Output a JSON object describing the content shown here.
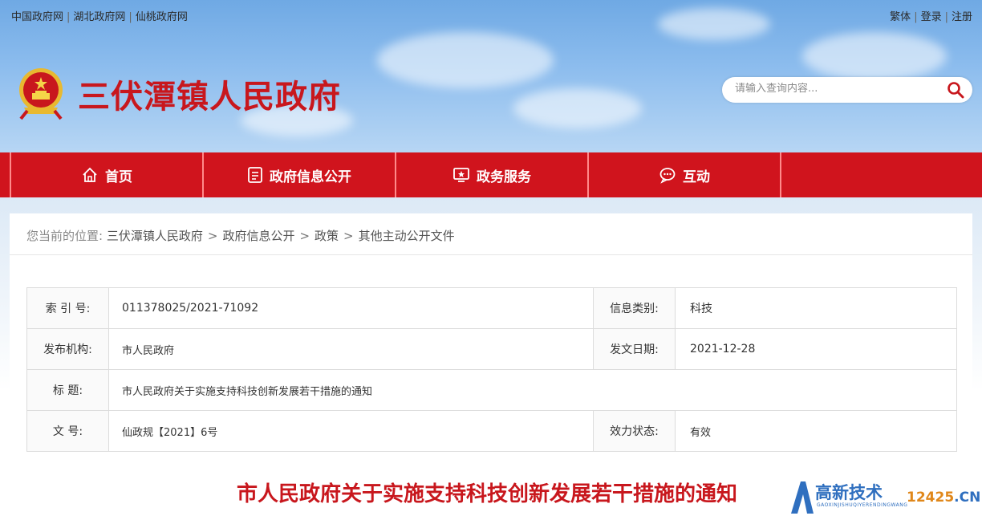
{
  "top_links": {
    "left": [
      "中国政府网",
      "湖北政府网",
      "仙桃政府网"
    ],
    "right": [
      "繁体",
      "登录",
      "注册"
    ],
    "separator": "|"
  },
  "header": {
    "site_title": "三伏潭镇人民政府",
    "emblem_icon": "national-emblem-icon",
    "search_placeholder": "请输入查询内容...",
    "search_icon": "search-icon"
  },
  "nav": {
    "items": [
      {
        "label": "首页",
        "icon": "home-icon"
      },
      {
        "label": "政府信息公开",
        "icon": "document-icon"
      },
      {
        "label": "政务服务",
        "icon": "service-screen-icon"
      },
      {
        "label": "互动",
        "icon": "chat-icon"
      }
    ],
    "bg_color": "#d0141d"
  },
  "breadcrumb": {
    "prefix": "您当前的位置:",
    "items": [
      "三伏潭镇人民政府",
      "政府信息公开",
      "政策",
      "其他主动公开文件"
    ],
    "separator": ">"
  },
  "meta_table": {
    "index_label": "索 引 号:",
    "index_value": "011378025/2021-71092",
    "category_label": "信息类别:",
    "category_value": "科技",
    "issuer_label": "发布机构:",
    "issuer_value": "市人民政府",
    "date_label": "发文日期:",
    "date_value": "2021-12-28",
    "title_label": "标 题:",
    "title_value": "市人民政府关于实施支持科技创新发展若干措施的通知",
    "docno_label": "文 号:",
    "docno_value": "仙政规【2021】6号",
    "status_label": "效力状态:",
    "status_value": "有效"
  },
  "document": {
    "title": "市人民政府关于实施支持科技创新发展若干措施的通知"
  },
  "watermark": {
    "text": "高新技术",
    "sub": "GAOXINJISHUQIYERENDINGWANG",
    "number": "12425",
    "suffix": ".CN"
  },
  "colors": {
    "brand_red": "#c8171d",
    "nav_red": "#d0141d",
    "watermark_blue": "#2f6fbf",
    "watermark_orange": "#e0871a"
  }
}
